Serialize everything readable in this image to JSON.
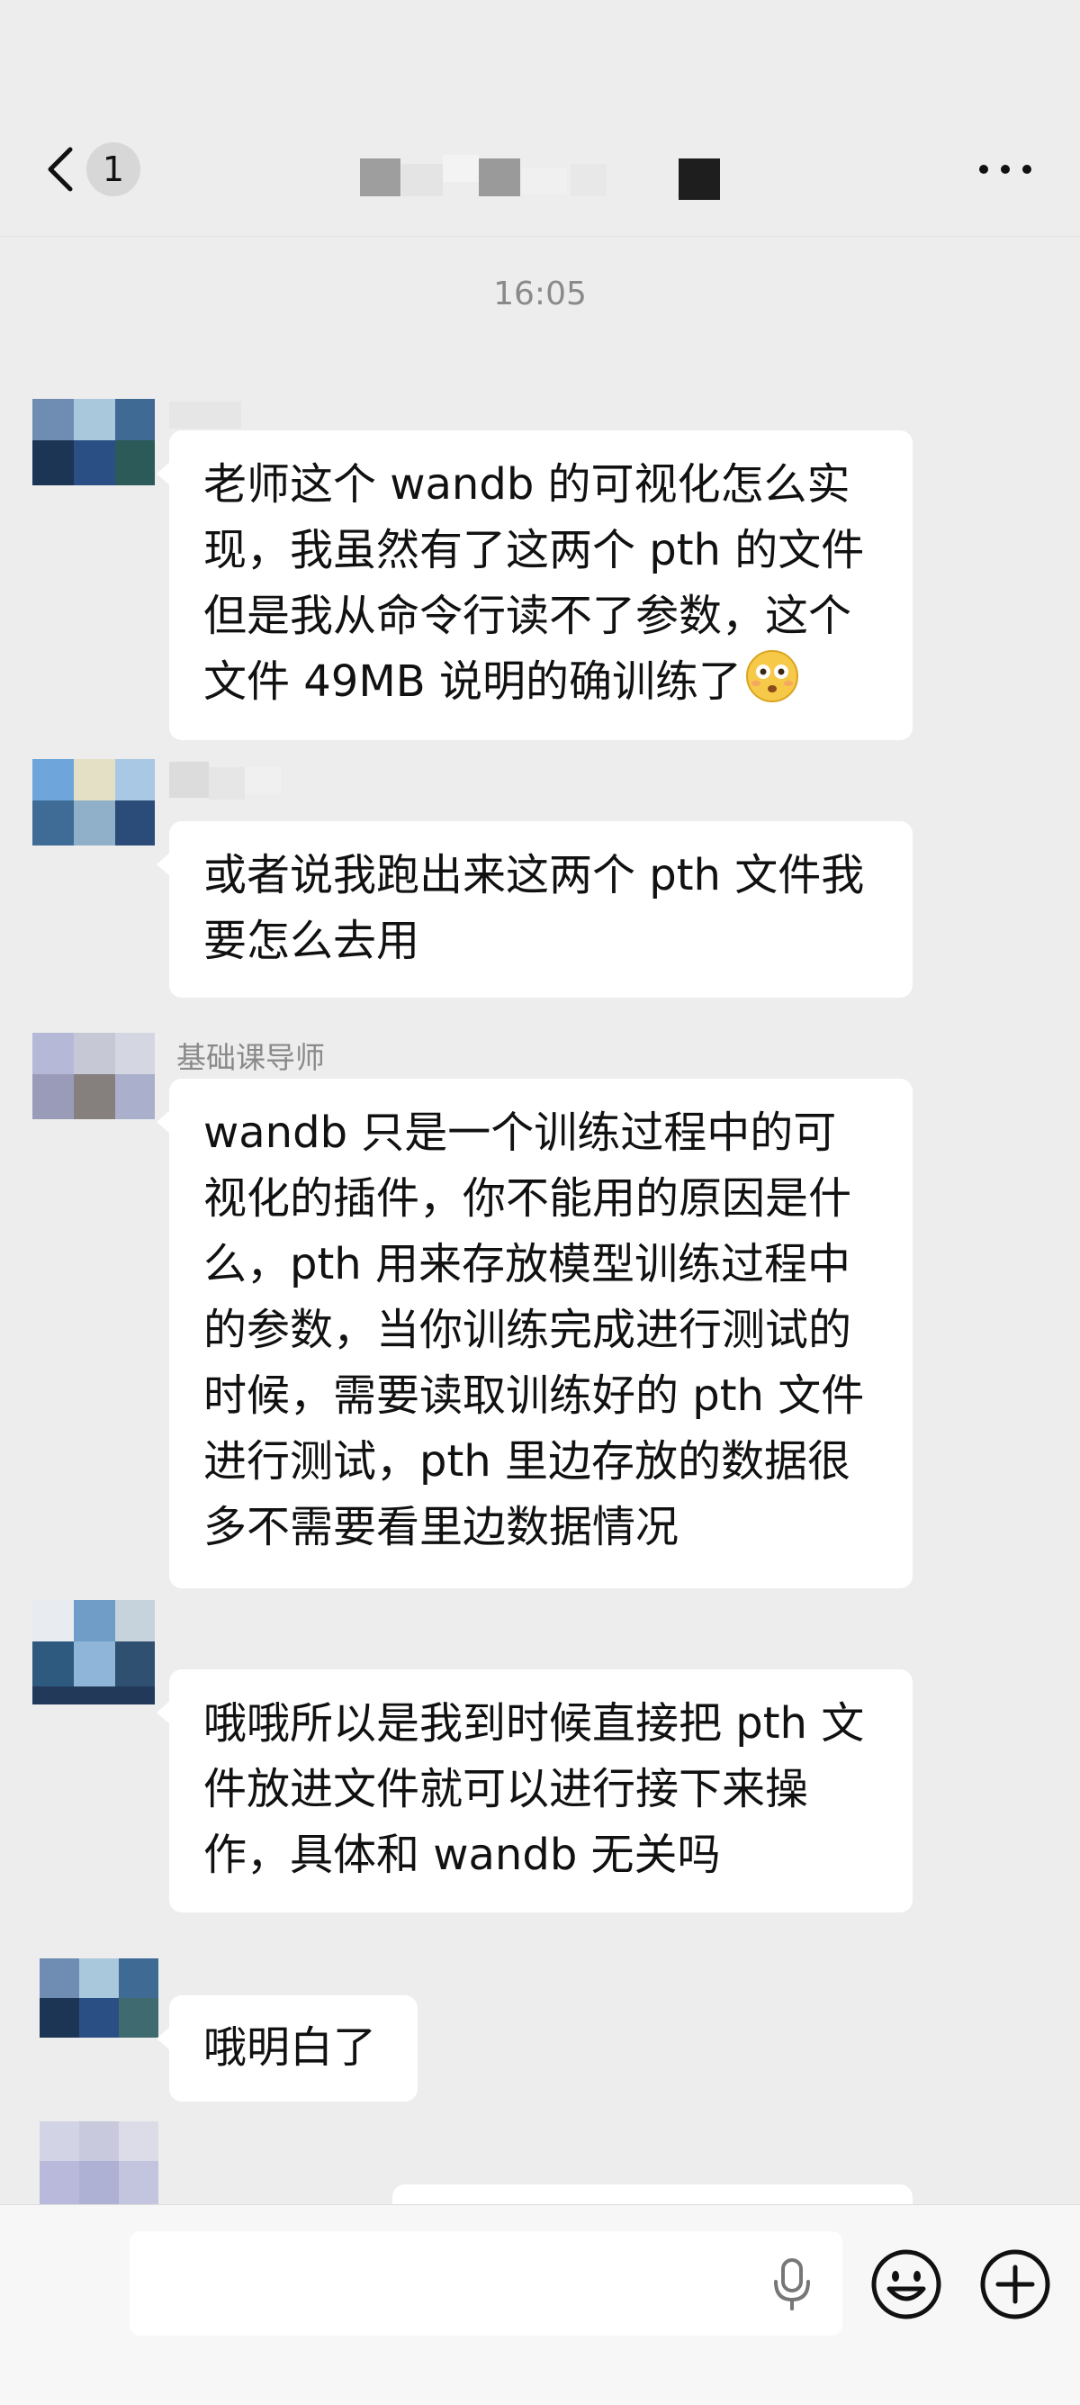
{
  "header": {
    "unread_count": "1",
    "back_icon": "chevron-left-icon",
    "more_icon": "more-dots-icon"
  },
  "chat": {
    "timestamp": "16:05",
    "messages": [
      {
        "sender": "",
        "lines": [
          "老师这个 wandb 的可视化怎么实",
          "现，我虽然有了这两个 pth 的文件",
          "但是我从命令行读不了参数，这个",
          "文件 49MB 说明的确训练了"
        ],
        "emoji": "flushed-face-emoji"
      },
      {
        "sender": "",
        "lines": [
          "或者说我跑出来这两个 pth 文件我",
          "要怎么去用"
        ]
      },
      {
        "sender": "基础课导师",
        "lines": [
          "wandb 只是一个训练过程中的可",
          "视化的插件，你不能用的原因是什",
          "么，pth 用来存放模型训练过程中",
          "的参数，当你训练完成进行测试的",
          "时候，需要读取训练好的 pth 文件",
          "进行测试，pth 里边存放的数据很",
          "多不需要看里边数据情况"
        ]
      },
      {
        "sender": "",
        "lines": [
          "哦哦所以是我到时候直接把 pth 文",
          "件放进文件就可以进行接下来操",
          "作，具体和 wandb 无关吗"
        ]
      },
      {
        "sender": "",
        "lines": [
          "哦明白了"
        ]
      }
    ]
  },
  "footer": {
    "input_value": "",
    "voice_icon": "microphone-icon",
    "emoji_icon": "smiley-icon",
    "more_icon": "plus-circle-icon"
  }
}
